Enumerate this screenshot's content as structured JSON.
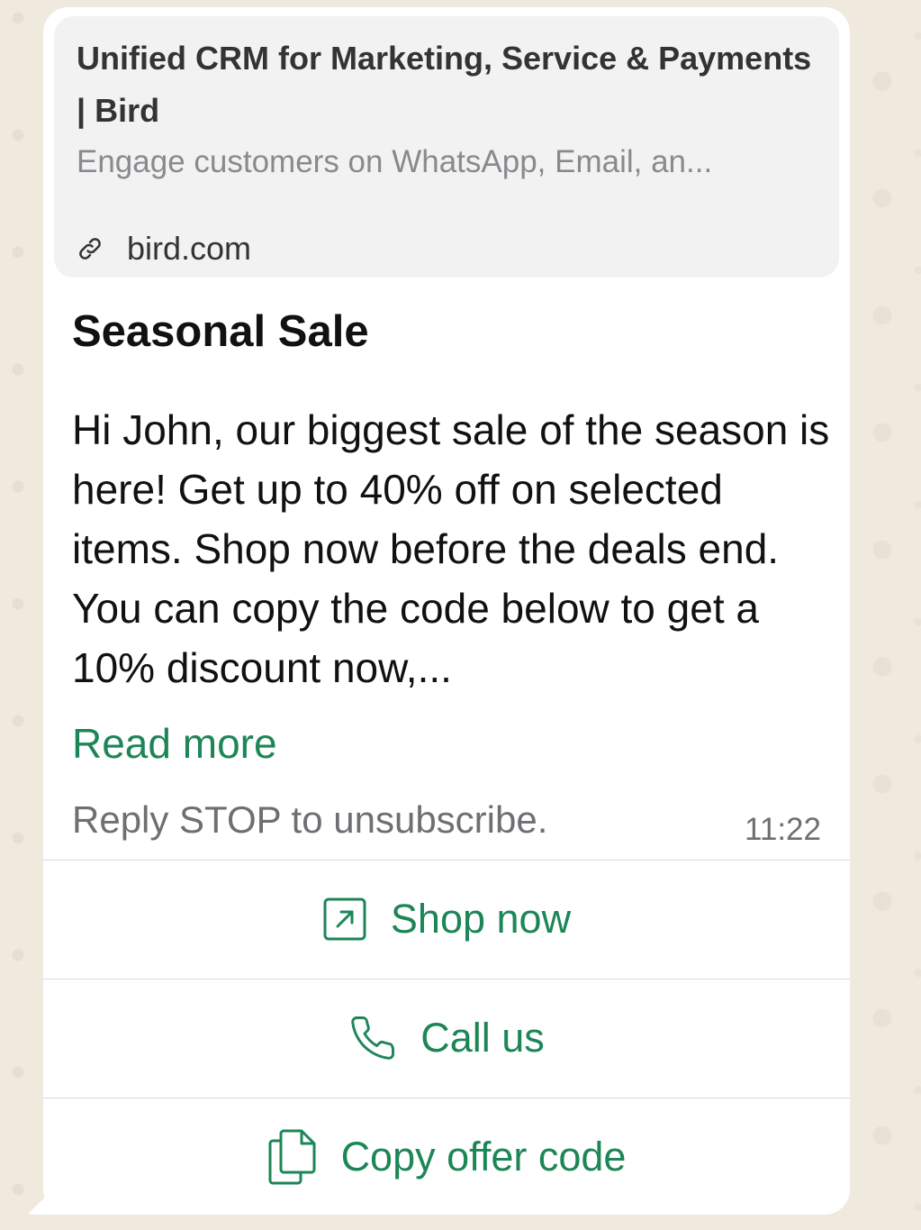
{
  "link_preview": {
    "title": "Unified CRM for Marketing, Service & Payments | Bird",
    "description": "Engage customers on WhatsApp, Email, an...",
    "domain": "bird.com",
    "icon": "link-icon"
  },
  "message": {
    "header": "Seasonal Sale",
    "body": "Hi John, our biggest sale of the season is here! Get up to 40% off on selected items. Shop now before the deals end. You can copy the code below to get a 10% discount now,...",
    "read_more": "Read more",
    "footer": "Reply STOP to unsubscribe.",
    "time": "11:22"
  },
  "buttons": [
    {
      "label": "Shop now",
      "icon": "external-link-icon"
    },
    {
      "label": "Call us",
      "icon": "phone-icon"
    },
    {
      "label": "Copy offer code",
      "icon": "copy-icon"
    }
  ],
  "colors": {
    "accent": "#1d8656",
    "bubble": "#ffffff",
    "preview_bg": "#f2f2f3",
    "wallpaper": "#f0e9de"
  }
}
